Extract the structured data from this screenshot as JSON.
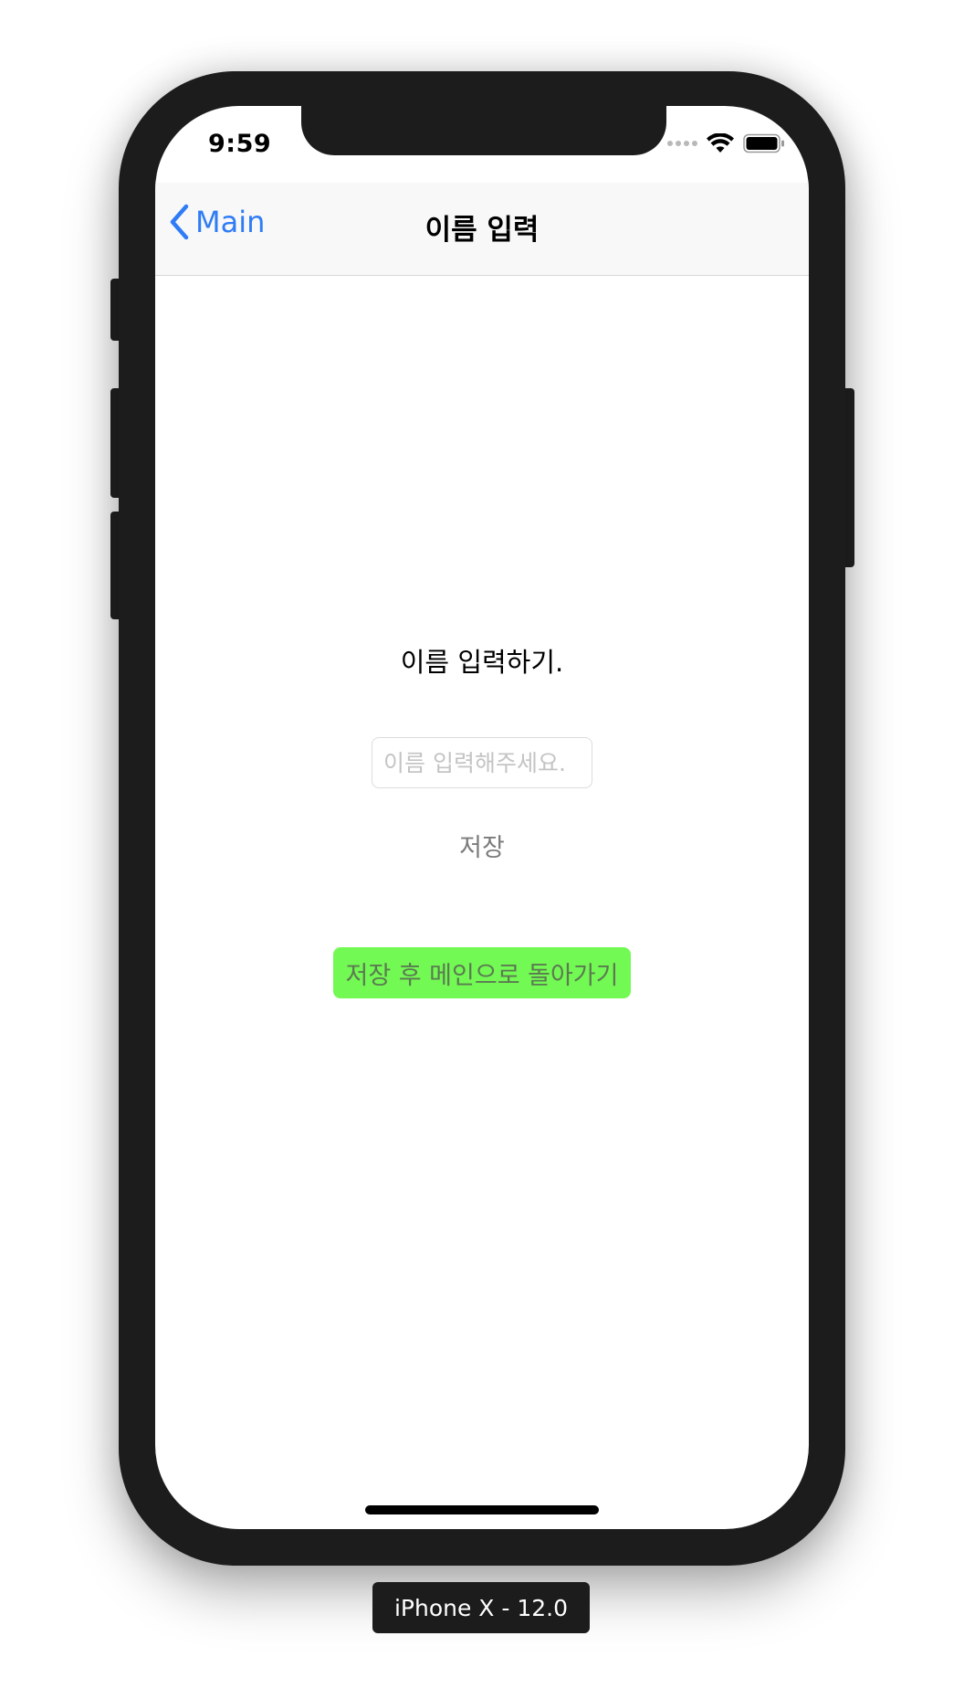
{
  "status_bar": {
    "time": "9:59"
  },
  "nav": {
    "back_label": "Main",
    "title": "이름 입력"
  },
  "content": {
    "heading": "이름 입력하기.",
    "name_input": {
      "value": "",
      "placeholder": "이름 입력해주세요."
    },
    "save_label": "저장",
    "save_and_return_label": "저장 후 메인으로 돌아가기"
  },
  "simulator": {
    "device_label": "iPhone X - 12.0"
  },
  "colors": {
    "tint": "#2f7cf6",
    "button_green": "#73f953",
    "frame": "#1c1c1c"
  },
  "icons": {
    "back": "chevron-left-icon",
    "signal": "cellular-signal-icon",
    "wifi": "wifi-icon",
    "battery": "battery-icon"
  }
}
